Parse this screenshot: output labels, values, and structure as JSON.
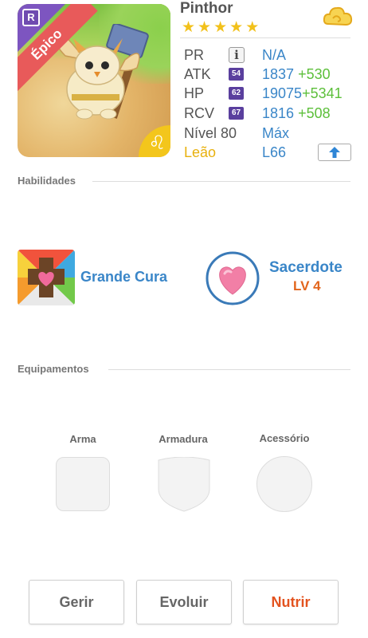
{
  "monster": {
    "name": "Pinthor",
    "stars": 5,
    "rarity_label": "Épico",
    "rarity_badge": "R",
    "zodiac_symbol": "♌"
  },
  "stats": {
    "pr": {
      "label": "PR",
      "value": "N/A"
    },
    "atk": {
      "label": "ATK",
      "tag": "54",
      "value": "1837",
      "bonus": "+530"
    },
    "hp": {
      "label": "HP",
      "tag": "62",
      "value": "19075",
      "bonus": "+5341"
    },
    "rcv": {
      "label": "RCV",
      "tag": "67",
      "value": "1816",
      "bonus": "+508"
    },
    "level": {
      "label": "Nível 80",
      "value": "Máx"
    },
    "element": {
      "label": "Leão",
      "value": "L66"
    }
  },
  "sections": {
    "skills_title": "Habilidades",
    "equipment_title": "Equipamentos"
  },
  "skills": {
    "active": {
      "name": "Grande Cura",
      "icon": "heart-cross-icon"
    },
    "leader": {
      "name": "Sacerdote",
      "level": "LV 4",
      "icon": "pink-heart-icon"
    }
  },
  "equipment": {
    "slots": [
      {
        "label": "Arma",
        "icon": "weapon-slot-icon"
      },
      {
        "label": "Armadura",
        "icon": "armor-slot-icon"
      },
      {
        "label": "Acessório",
        "icon": "accessory-slot-icon"
      }
    ]
  },
  "actions": {
    "manage": "Gerir",
    "evolve": "Evoluir",
    "feed": "Nutrir"
  },
  "colors": {
    "accent_blue": "#3a86c8",
    "bonus_green": "#5cbf3a",
    "gold": "#e8b10e",
    "primary_action": "#e3531f",
    "epic_ribbon": "#e85a5a"
  }
}
